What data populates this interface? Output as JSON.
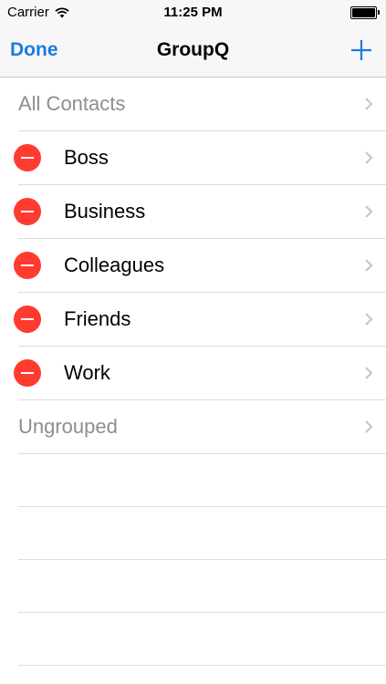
{
  "status_bar": {
    "carrier": "Carrier",
    "time": "11:25 PM",
    "wifi_icon": "wifi-icon",
    "battery_level": 1.0
  },
  "nav": {
    "left_button": "Done",
    "title": "GroupQ",
    "right_icon": "plus-icon"
  },
  "groups": {
    "all_contacts": "All Contacts",
    "editable": [
      {
        "label": "Boss"
      },
      {
        "label": "Business"
      },
      {
        "label": "Colleagues"
      },
      {
        "label": "Friends"
      },
      {
        "label": "Work"
      }
    ],
    "ungrouped": "Ungrouped"
  },
  "colors": {
    "accent": "#1a7ce0",
    "delete": "#ff3b30",
    "secondary_text": "#8e8e93"
  }
}
